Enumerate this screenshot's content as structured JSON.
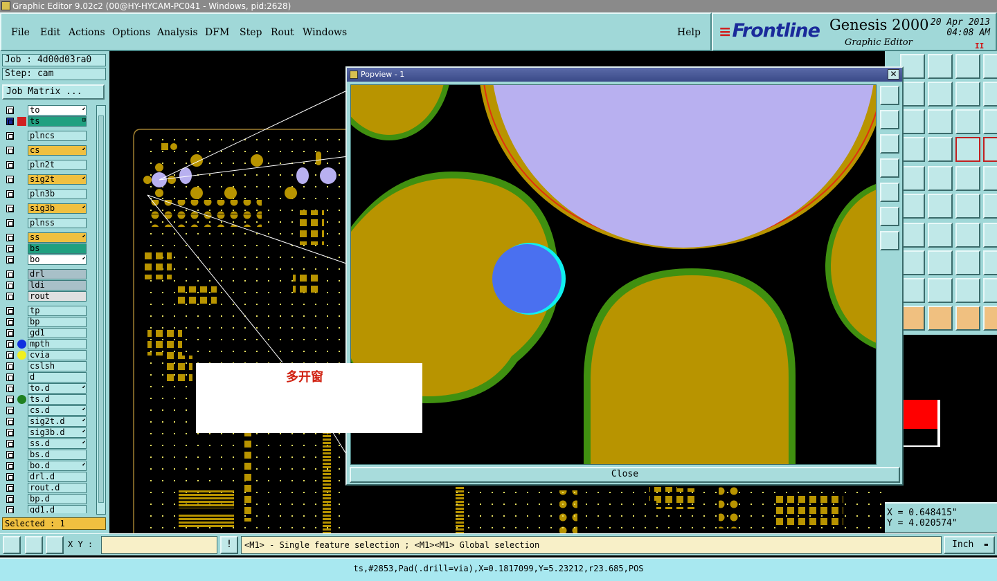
{
  "window": {
    "title": "Graphic Editor 9.02c2 (00@HY-HYCAM-PC041 - Windows, pid:2628)"
  },
  "menu": {
    "items": [
      "File",
      "Edit",
      "Actions",
      "Options",
      "Analysis",
      "DFM",
      "Step",
      "Rout",
      "Windows"
    ],
    "help": "Help"
  },
  "brand": {
    "logo": "Frontline",
    "product": "Genesis 2000",
    "subtitle": "Graphic Editor",
    "date": "20 Apr 2013",
    "time": "04:08 AM",
    "pause": "II"
  },
  "job": {
    "job_label": "Job : 4d00d03ra0",
    "step_label": "Step: cam",
    "matrix_button": "Job Matrix ..."
  },
  "layers": [
    {
      "name": "to",
      "color": "#ffffff",
      "arrow": "⬋"
    },
    {
      "name": "ts",
      "color": "#20a080",
      "arrow": "⊞",
      "active": true
    },
    {
      "name": "plncs",
      "color": "#b8e8e8",
      "arrow": ""
    },
    {
      "name": "cs",
      "color": "#f0c040",
      "arrow": "⬋"
    },
    {
      "name": "pln2t",
      "color": "#b8e8e8",
      "arrow": ""
    },
    {
      "name": "sig2t",
      "color": "#f0c040",
      "arrow": "⬋"
    },
    {
      "name": "pln3b",
      "color": "#b8e8e8",
      "arrow": ""
    },
    {
      "name": "sig3b",
      "color": "#f0c040",
      "arrow": "⬋"
    },
    {
      "name": "plnss",
      "color": "#b8e8e8",
      "arrow": ""
    },
    {
      "name": "ss",
      "color": "#f0c040",
      "arrow": "⬋"
    },
    {
      "name": "bs",
      "color": "#20a080",
      "arrow": ""
    },
    {
      "name": "bo",
      "color": "#ffffff",
      "arrow": "⬋"
    },
    {
      "name": "drl",
      "color": "#a8c0c8",
      "arrow": ""
    },
    {
      "name": "ldi",
      "color": "#a8c0c8",
      "arrow": ""
    },
    {
      "name": "rout",
      "color": "#e0e0e0",
      "arrow": ""
    },
    {
      "name": "tp",
      "color": "#b8e8e8",
      "arrow": ""
    },
    {
      "name": "bp",
      "color": "#b8e8e8",
      "arrow": ""
    },
    {
      "name": "gd1",
      "color": "#b8e8e8",
      "arrow": ""
    },
    {
      "name": "mpth",
      "color": "#b8e8e8",
      "arrow": "",
      "dot": "#1030e0"
    },
    {
      "name": "cvia",
      "color": "#b8e8e8",
      "arrow": "",
      "dot": "#f0f020"
    },
    {
      "name": "cslsh",
      "color": "#b8e8e8",
      "arrow": ""
    },
    {
      "name": "d",
      "color": "#b8e8e8",
      "arrow": ""
    },
    {
      "name": "to.d",
      "color": "#b8e8e8",
      "arrow": "⬋"
    },
    {
      "name": "ts.d",
      "color": "#b8e8e8",
      "arrow": "",
      "dot": "#208020"
    },
    {
      "name": "cs.d",
      "color": "#b8e8e8",
      "arrow": "⬋"
    },
    {
      "name": "sig2t.d",
      "color": "#b8e8e8",
      "arrow": "⬋"
    },
    {
      "name": "sig3b.d",
      "color": "#b8e8e8",
      "arrow": "⬋"
    },
    {
      "name": "ss.d",
      "color": "#b8e8e8",
      "arrow": "⬋"
    },
    {
      "name": "bs.d",
      "color": "#b8e8e8",
      "arrow": ""
    },
    {
      "name": "bo.d",
      "color": "#b8e8e8",
      "arrow": "⬋"
    },
    {
      "name": "drl.d",
      "color": "#b8e8e8",
      "arrow": ""
    },
    {
      "name": "rout.d",
      "color": "#b8e8e8",
      "arrow": ""
    },
    {
      "name": "bp.d",
      "color": "#b8e8e8",
      "arrow": ""
    },
    {
      "name": "gd1.d",
      "color": "#b8e8e8",
      "arrow": ""
    }
  ],
  "selected": "Selected : 1",
  "popview": {
    "title": "Popview - 1",
    "close_label": "Close",
    "close_x": "✕"
  },
  "annotation": {
    "text": "多开窗"
  },
  "coords": {
    "x": "X = 0.648415\"",
    "y": "Y = 4.020574\""
  },
  "bottom": {
    "xy_label": "X Y :",
    "xy_value": "",
    "hint": "<M1> - Single feature selection ; <M1><M1> Global selection",
    "unit": "Inch",
    "unit_arrow": "▬"
  },
  "status": "ts,#2853,Pad(.drill=via),X=0.1817099,Y=5.23212,r23.685,POS",
  "colors": {
    "copper": "#b89400",
    "pad_edge": "#409010",
    "selected": "#b8b0f0",
    "highlight_blue": "#4a70f0",
    "cyan": "#10f0f0",
    "teal_ui": "#a0d8d8"
  }
}
